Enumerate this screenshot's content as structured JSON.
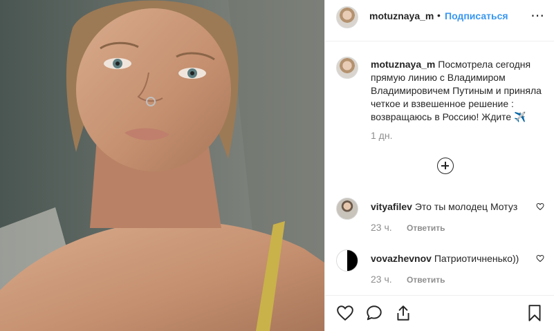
{
  "post": {
    "username": "motuznaya_m",
    "dot": "•",
    "follow_label": "Подписаться",
    "more_icon": "⋯"
  },
  "caption": {
    "username": "motuznaya_m",
    "text": "Посмотрела сегодня прямую линию с Владимиром Владимировичем Путиным и приняла четкое и взвешенное решение : возвращаюсь в Россию! Ждите ✈️",
    "time": "1 дн."
  },
  "comments": [
    {
      "username": "vityafilev",
      "text": "Это ты молодец Мотуз",
      "time": "23 ч.",
      "reply_label": "Ответить"
    },
    {
      "username": "vovazhevnov",
      "text": "Патриотичненько))",
      "time": "23 ч.",
      "reply_label": "Ответить"
    }
  ],
  "icons": {
    "load_more": "plus-circle-icon",
    "like": "heart-icon",
    "comment": "comment-icon",
    "share": "share-icon",
    "save": "bookmark-icon"
  },
  "colors": {
    "follow": "#3897f0",
    "text": "#262626",
    "muted": "#8e8e8e",
    "divider": "#efefef"
  }
}
